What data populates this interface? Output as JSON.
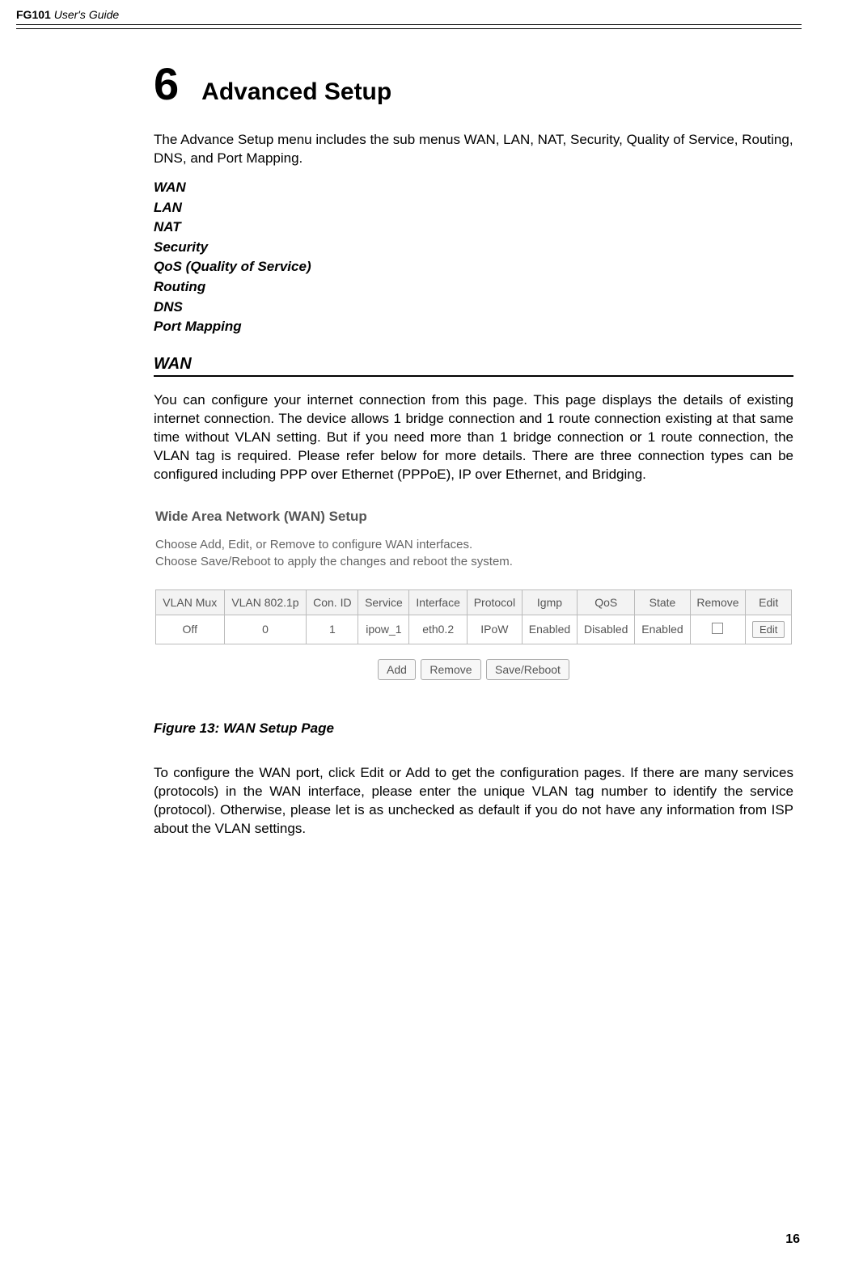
{
  "header": {
    "product": "FG101",
    "doc": "User's Guide"
  },
  "chapter": {
    "number": "6",
    "title": "Advanced Setup"
  },
  "intro": "The Advance Setup menu includes the sub menus WAN, LAN, NAT, Security, Quality of Service, Routing, DNS, and Port Mapping.",
  "menu_items": [
    "WAN",
    "LAN",
    "NAT",
    "Security",
    "QoS (Quality of Service)",
    "Routing",
    "DNS",
    "Port Mapping"
  ],
  "wan_section": {
    "heading": "WAN",
    "para1": "You can configure your internet connection from this page. This page displays the details of existing internet connection. The device allows 1 bridge connection and 1 route connection existing at that same time without VLAN setting. But if you need more than 1 bridge connection or 1 route connection, the VLAN tag is required. Please refer below for more details. There are three connection types can be configured including PPP over Ethernet (PPPoE), IP over Ethernet, and Bridging.",
    "figure_caption": "Figure 13: WAN Setup Page",
    "para2": "To configure the WAN port, click Edit or Add to get the configuration pages. If there are many services (protocols) in the WAN interface, please enter the unique VLAN tag number to identify the service (protocol). Otherwise, please let is as unchecked as default if you do not have any information from ISP about the VLAN settings."
  },
  "screenshot": {
    "title": "Wide Area Network (WAN) Setup",
    "info_line1": "Choose Add, Edit, or Remove to configure WAN interfaces.",
    "info_line2": "Choose Save/Reboot to apply the changes and reboot the system.",
    "headers": [
      "VLAN Mux",
      "VLAN 802.1p",
      "Con. ID",
      "Service",
      "Interface",
      "Protocol",
      "Igmp",
      "QoS",
      "State",
      "Remove",
      "Edit"
    ],
    "row": {
      "vlan_mux": "Off",
      "vlan_8021p": "0",
      "con_id": "1",
      "service": "ipow_1",
      "interface": "eth0.2",
      "protocol": "IPoW",
      "igmp": "Enabled",
      "qos": "Disabled",
      "state": "Enabled",
      "edit_btn": "Edit"
    },
    "buttons": {
      "add": "Add",
      "remove": "Remove",
      "save_reboot": "Save/Reboot"
    }
  },
  "page_number": "16"
}
